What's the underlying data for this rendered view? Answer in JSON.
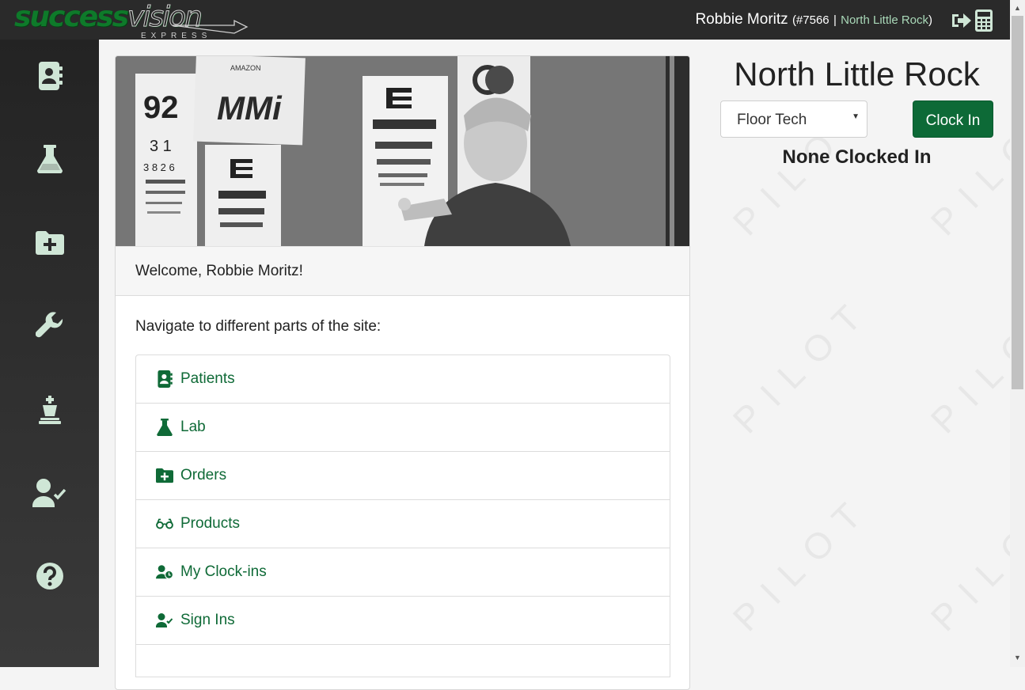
{
  "header": {
    "logo": {
      "main": "success",
      "vision": "vision",
      "sub": "EXPRESS"
    },
    "user_name": "Robbie Moritz",
    "user_id_text": "(#7566",
    "separator": "|",
    "user_location": "North Little Rock",
    "close_paren": ")",
    "icons": [
      "logout-icon",
      "calculator-icon"
    ]
  },
  "sidebar": {
    "items": [
      {
        "icon": "address-book-icon"
      },
      {
        "icon": "flask-icon"
      },
      {
        "icon": "folder-plus-icon"
      },
      {
        "icon": "wrench-icon"
      },
      {
        "icon": "chess-king-icon"
      },
      {
        "icon": "user-check-icon"
      },
      {
        "icon": "question-circle-icon"
      }
    ]
  },
  "main": {
    "welcome": "Welcome, Robbie Moritz!",
    "nav_intro": "Navigate to different parts of the site:",
    "nav_items": [
      {
        "label": "Patients",
        "icon": "address-book-icon"
      },
      {
        "label": "Lab",
        "icon": "flask-icon"
      },
      {
        "label": "Orders",
        "icon": "folder-plus-icon"
      },
      {
        "label": "Products",
        "icon": "glasses-icon"
      },
      {
        "label": "My Clock-ins",
        "icon": "user-clock-icon"
      },
      {
        "label": "Sign Ins",
        "icon": "user-check-icon"
      }
    ],
    "hero": {
      "chart_numbers": "92",
      "chart_row2": "3 1",
      "chart_row3": "3 8 2 6",
      "poster_text": "MMi",
      "poster_small": "AMAZON"
    }
  },
  "right_panel": {
    "location": "North Little Rock",
    "role_select_value": "Floor Tech",
    "clock_in_label": "Clock In",
    "status": "None Clocked In",
    "watermark": "PILOT"
  },
  "colors": {
    "brand_green": "#0d6a37",
    "sidebar_dark": "#2a2a2a",
    "icon_light": "#cfe6d6"
  }
}
